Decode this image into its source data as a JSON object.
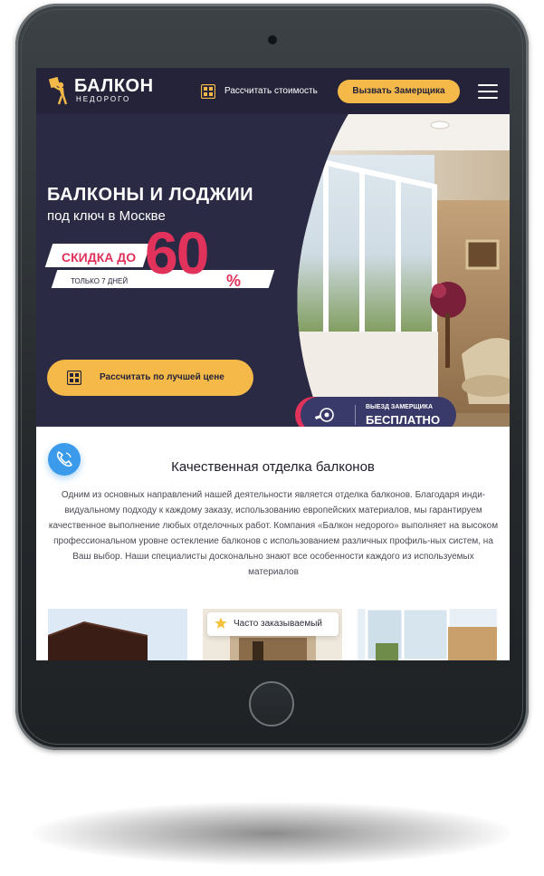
{
  "brand": {
    "title": "БАЛКОН",
    "subtitle": "НЕДОРОГО"
  },
  "header": {
    "calc_link": "Рассчитать стоимость",
    "call_button": "Вызвать Замерщика"
  },
  "hero": {
    "title": "БАЛКОНЫ И ЛОДЖИИ",
    "subtitle": "под ключ в Москве",
    "promo_main": "СКИДКА ДО",
    "promo_number": "60",
    "promo_percent": "%",
    "promo_days": "ТОЛЬКО 7 ДНЕЙ",
    "cta_button": "Рассчитать по лучшей цене",
    "badge_line1": "ВЫЕЗД ЗАМЕРЩИКА",
    "badge_line2": "БЕСПЛАТНО"
  },
  "section": {
    "title": "Качественная отделка балконов",
    "body": "Одним из основных направлений нашей деятельности является отделка балконов. Благодаря инди-видуальному подходу к каждому заказу, использованию европейских материалов, мы гарантируем качественное выполнение любых отделочных работ. Компания «Балкон недорого» выполняет на высоком профессиональном уровне остекление балконов с использованием различных профиль-ных систем, на Ваш выбор. Наши специалисты досконально знают все особенности каждого из используемых материалов"
  },
  "cards": {
    "tag_label": "Часто заказываемый"
  },
  "colors": {
    "header_bg": "#242339",
    "accent_yellow": "#f5b94a",
    "accent_red": "#e0325a",
    "phone_blue": "#3b9bea"
  },
  "icons": [
    "logo-mascot-icon",
    "calculator-icon",
    "menu-icon",
    "phone-icon",
    "tape-measure-icon",
    "star-icon"
  ]
}
